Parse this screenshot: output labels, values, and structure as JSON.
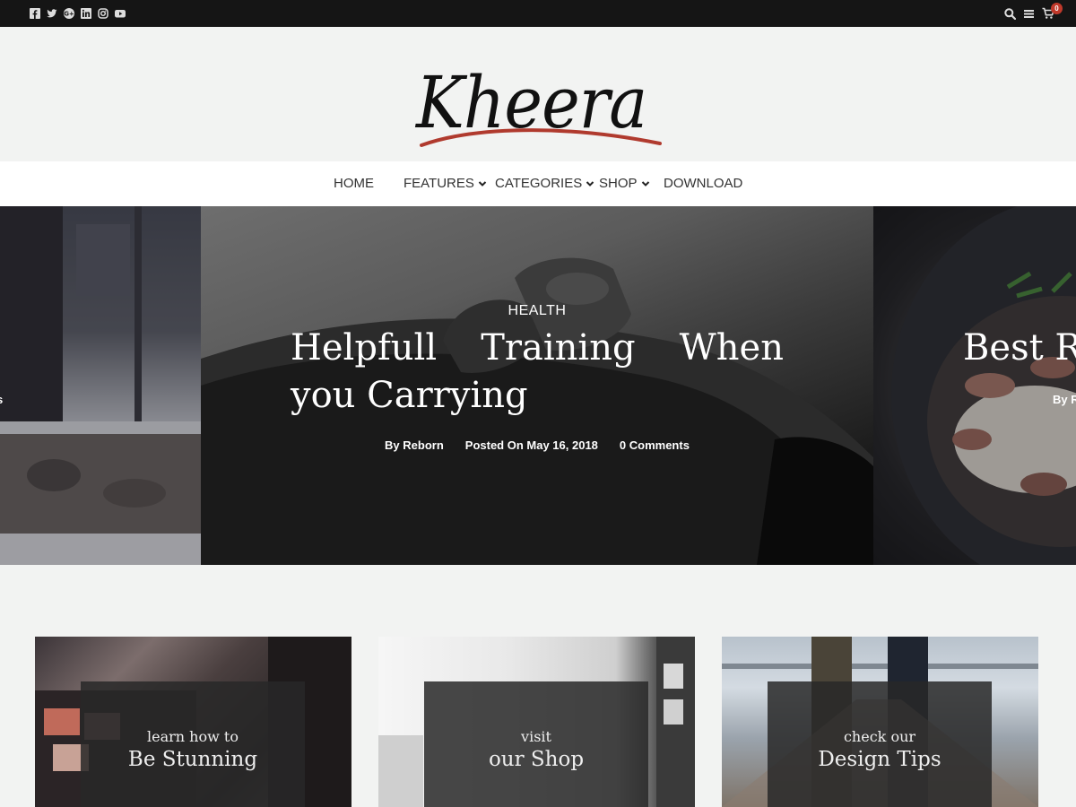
{
  "topbar": {
    "social_icons": [
      "facebook-icon",
      "twitter-icon",
      "google-plus-icon",
      "linkedin-icon",
      "instagram-icon",
      "youtube-icon"
    ],
    "tool_icons": [
      "search-icon",
      "menu-icon",
      "cart-icon"
    ],
    "cart_count": "0"
  },
  "header": {
    "logo_text": "Kheera",
    "accent_color": "#b03a2e"
  },
  "nav": {
    "items": [
      {
        "label": "HOME",
        "has_dropdown": false
      },
      {
        "label": "FEATURES",
        "has_dropdown": true
      },
      {
        "label": "CATEGORIES",
        "has_dropdown": true
      },
      {
        "label": "SHOP",
        "has_dropdown": true
      },
      {
        "label": "DOWNLOAD",
        "has_dropdown": false
      }
    ]
  },
  "slider": {
    "left": {
      "meta_fragment": "s"
    },
    "main": {
      "category": "HEALTH",
      "title": "Helpfull Training When you Carrying",
      "author": "By Reborn",
      "date": "Posted On May 16, 2018",
      "comments": "0 Comments"
    },
    "right": {
      "title_fragment": "Best Re",
      "meta_fragment": "By R"
    }
  },
  "cards": [
    {
      "small": "learn how to",
      "big": "Be Stunning"
    },
    {
      "small": "visit",
      "big": "our Shop"
    },
    {
      "small": "check our",
      "big": "Design Tips"
    }
  ]
}
